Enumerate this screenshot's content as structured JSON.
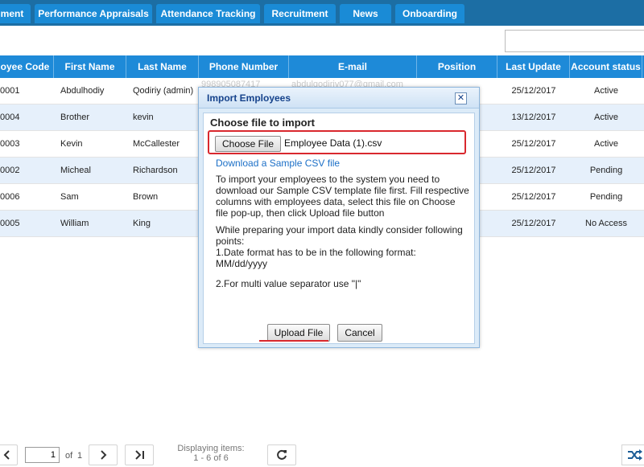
{
  "tabs": [
    {
      "label": "ment"
    },
    {
      "label": "Performance Appraisals"
    },
    {
      "label": "Attendance Tracking"
    },
    {
      "label": "Recruitment"
    },
    {
      "label": "News"
    },
    {
      "label": "Onboarding"
    }
  ],
  "table": {
    "headers": [
      "oyee Code",
      "First Name",
      "Last Name",
      "Phone Number",
      "E-mail",
      "Position",
      "Last Update",
      "Account status"
    ],
    "rows": [
      {
        "code": "0001",
        "first": "Abdulhodiy",
        "last": "Qodiriy (admin)",
        "phone": "998905087417",
        "email": "abdulqodiriy077@gmail.com",
        "update": "25/12/2017",
        "status": "Active"
      },
      {
        "code": "0004",
        "first": "Brother",
        "last": "kevin",
        "update": "13/12/2017",
        "status": "Active"
      },
      {
        "code": "0003",
        "first": "Kevin",
        "last": "McCallester",
        "update": "25/12/2017",
        "status": "Active"
      },
      {
        "code": "0002",
        "first": "Micheal",
        "last": "Richardson",
        "update": "25/12/2017",
        "status": "Pending"
      },
      {
        "code": "0006",
        "first": "Sam",
        "last": "Brown",
        "update": "25/12/2017",
        "status": "Pending"
      },
      {
        "code": "0005",
        "first": "William",
        "last": "King",
        "update": "25/12/2017",
        "status": "No Access"
      }
    ]
  },
  "pager": {
    "page": "1",
    "of_label": "of",
    "total_pages": "1",
    "display_label": "Displaying items:",
    "display_range": "1 - 6 of 6"
  },
  "modal": {
    "title": "Import Employees",
    "close_glyph": "✕",
    "heading": "Choose file to import",
    "choose_button": "Choose File",
    "file_name": "Employee Data (1).csv",
    "sample_link": "Download a Sample CSV file",
    "info_1": "To import your employees to the system you need to download our Sample CSV template file first. Fill respective columns with employees data, select this file on Choose file pop-up, then click Upload file button",
    "info_2": "While preparing your import data kindly consider following points:",
    "info_3": "1.Date format has to be in the following format: MM/dd/yyyy",
    "info_4": "2.For multi value separator use \"|\"",
    "upload_button": "Upload File",
    "cancel_button": "Cancel"
  },
  "colors": {
    "accent": "#1e8ad8",
    "highlight": "#d9282e",
    "link": "#1b6fc7"
  }
}
